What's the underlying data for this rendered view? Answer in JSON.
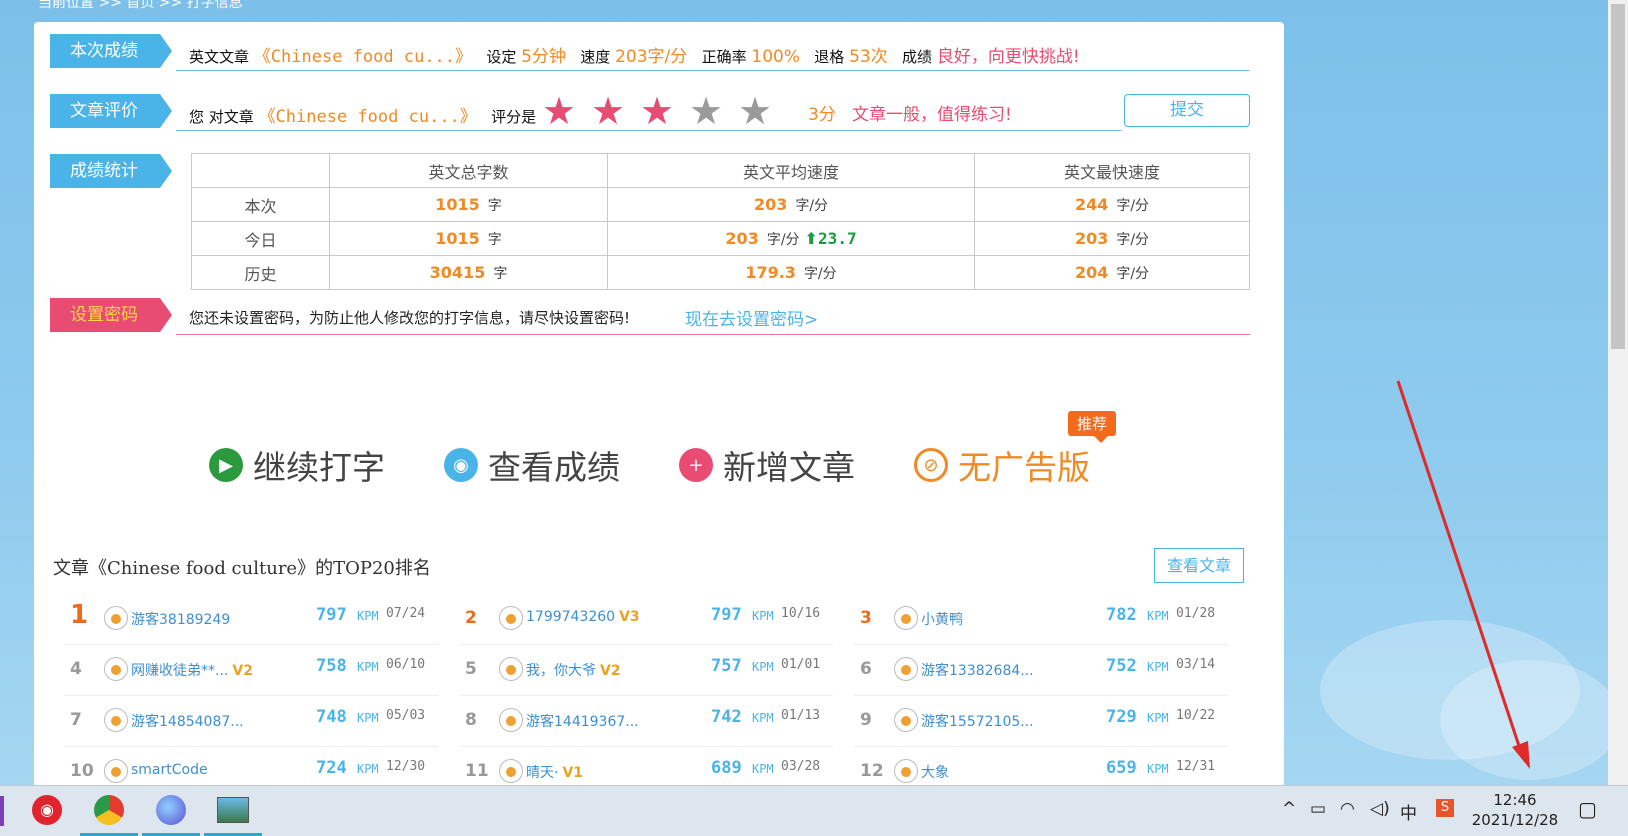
{
  "breadcrumb": "当前位置 >> 首页 >> 打字信息",
  "score_row": {
    "label": "本次成绩",
    "article_label": "英文文章",
    "article_title": "《Chinese food cu...》",
    "set_label": "设定",
    "set_value": "5分钟",
    "speed_label": "速度",
    "speed_value": "203字/分",
    "accuracy_label": "正确率",
    "accuracy_value": "100%",
    "backspace_label": "退格",
    "backspace_value": "53次",
    "result_label": "成绩",
    "result_value": "良好，向更快挑战!"
  },
  "rating_row": {
    "label": "文章评价",
    "prefix": "您 对文章",
    "article_title": "《Chinese food cu...》",
    "rated_label": "评分是",
    "rating": 3,
    "rating_max": 5,
    "score_text": "3分",
    "comment": "文章一般，值得练习!",
    "submit_label": "提交"
  },
  "stats_row": {
    "label": "成绩统计",
    "headers": [
      "",
      "英文总字数",
      "英文平均速度",
      "英文最快速度"
    ],
    "unit_chars": "字",
    "unit_speed": "字/分",
    "rows": [
      {
        "name": "本次",
        "total": "1015",
        "avg": "203",
        "fastest": "244",
        "trend": ""
      },
      {
        "name": "今日",
        "total": "1015",
        "avg": "203",
        "fastest": "203",
        "trend": "23.7"
      },
      {
        "name": "历史",
        "total": "30415",
        "avg": "179.3",
        "fastest": "204",
        "trend": ""
      }
    ]
  },
  "password_row": {
    "label": "设置密码",
    "message": "您还未设置密码，为防止他人修改您的打字信息，请尽快设置密码!",
    "link": "现在去设置密码>"
  },
  "actions": {
    "continue": "继续打字",
    "view_score": "查看成绩",
    "add_article": "新增文章",
    "ad_free": "无广告版",
    "recommend_badge": "推荐"
  },
  "ranking": {
    "title": "文章《Chinese food culture》的TOP20排名",
    "view_article": "查看文章",
    "kpm_unit": "KPM",
    "entries": [
      {
        "rank": "1",
        "name": "游客38189249",
        "badge": "",
        "kpm": "797",
        "date": "07/24"
      },
      {
        "rank": "2",
        "name": "1799743260",
        "badge": "V3",
        "kpm": "797",
        "date": "10/16"
      },
      {
        "rank": "3",
        "name": "小黄鸭",
        "badge": "",
        "kpm": "782",
        "date": "01/28"
      },
      {
        "rank": "4",
        "name": "网赚收徒弟**...",
        "badge": "V2",
        "kpm": "758",
        "date": "06/10"
      },
      {
        "rank": "5",
        "name": "我，你大爷",
        "badge": "V2",
        "kpm": "757",
        "date": "01/01"
      },
      {
        "rank": "6",
        "name": "游客13382684...",
        "badge": "",
        "kpm": "752",
        "date": "03/14"
      },
      {
        "rank": "7",
        "name": "游客14854087...",
        "badge": "",
        "kpm": "748",
        "date": "05/03"
      },
      {
        "rank": "8",
        "name": "游客14419367...",
        "badge": "",
        "kpm": "742",
        "date": "01/13"
      },
      {
        "rank": "9",
        "name": "游客15572105...",
        "badge": "",
        "kpm": "729",
        "date": "10/22"
      },
      {
        "rank": "10",
        "name": "smartCode",
        "badge": "",
        "kpm": "724",
        "date": "12/30"
      },
      {
        "rank": "11",
        "name": "晴天·",
        "badge": "V1",
        "kpm": "689",
        "date": "03/28"
      },
      {
        "rank": "12",
        "name": "大象",
        "badge": "",
        "kpm": "659",
        "date": "12/31"
      }
    ]
  },
  "taskbar": {
    "time": "12:46",
    "date": "2021/12/28",
    "ime": "中",
    "apps": [
      "netease-music-icon",
      "chrome-icon",
      "browser-planet-icon",
      "photos-icon"
    ]
  },
  "colors": {
    "blue": "#4ab4e8",
    "pink": "#e84c72",
    "orange": "#f08a24",
    "green": "#1a9b3f"
  }
}
